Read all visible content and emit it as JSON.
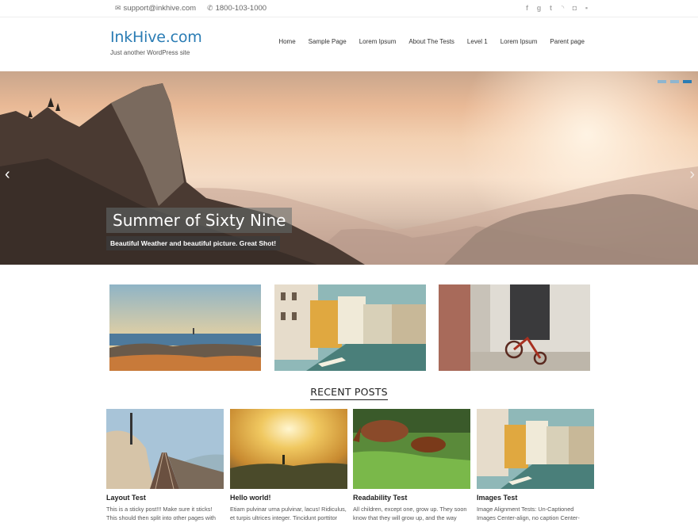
{
  "topbar": {
    "email": "support@inkhive.com",
    "phone": "1800-103-1000",
    "social_icons": [
      "facebook-icon",
      "google-plus-icon",
      "twitter-icon",
      "rss-icon",
      "instagram-icon",
      "flickr-icon"
    ]
  },
  "site": {
    "title": "InkHive.com",
    "tagline": "Just another WordPress site"
  },
  "nav": {
    "items": [
      "Home",
      "Sample Page",
      "Lorem Ipsum",
      "About The Tests",
      "Level 1",
      "Lorem Ipsum",
      "Parent page"
    ]
  },
  "slider": {
    "title": "Summer of Sixty Nine",
    "subtitle": "Beautiful Weather and beautiful picture. Great Shot!",
    "slide_count": 3,
    "active_slide": 3
  },
  "recent": {
    "heading": "RECENT POSTS",
    "posts": [
      {
        "title": "Layout Test",
        "excerpt": "This is a sticky post!!! Make sure it sticks! This should then split into other pages with"
      },
      {
        "title": "Hello world!",
        "excerpt": "Etiam pulvinar urna pulvinar, lacus! Ridiculus, et turpis ultrices integer. Tincidunt porttitor"
      },
      {
        "title": "Readability Test",
        "excerpt": "All children, except one, grow up. They soon know that they will grow up, and the way"
      },
      {
        "title": "Images Test",
        "excerpt": "Image Alignment Tests: Un-Captioned Images Center-align, no caption Center-aligned image"
      }
    ]
  },
  "colors": {
    "accent": "#2a7cb4",
    "text": "#333333"
  }
}
